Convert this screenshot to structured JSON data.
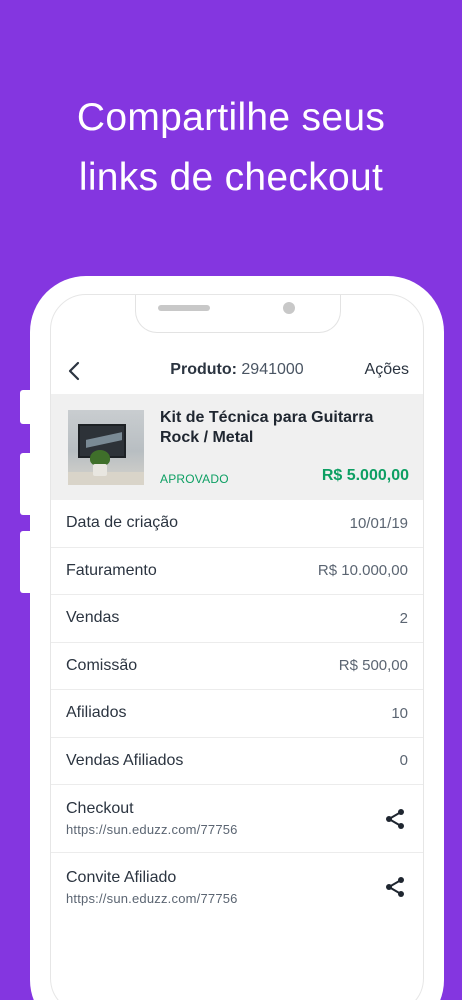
{
  "headline": {
    "line1": "Compartilhe seus",
    "line2": "links de checkout"
  },
  "header": {
    "back_icon": "chevron-left-icon",
    "title_label": "Produto:",
    "title_value": "2941000",
    "actions_label": "Ações"
  },
  "product": {
    "name": "Kit de Técnica para Guitarra Rock / Metal",
    "status": "APROVADO",
    "price": "R$ 5.000,00",
    "accent_color": "#0d9f63"
  },
  "details": [
    {
      "label": "Data de criação",
      "value": "10/01/19"
    },
    {
      "label": "Faturamento",
      "value": "R$ 10.000,00"
    },
    {
      "label": "Vendas",
      "value": "2"
    },
    {
      "label": "Comissão",
      "value": "R$ 500,00"
    },
    {
      "label": "Afiliados",
      "value": "10"
    },
    {
      "label": "Vendas Afiliados",
      "value": "0"
    }
  ],
  "links": [
    {
      "label": "Checkout",
      "url": "https://sun.eduzz.com/77756",
      "icon": "share-icon"
    },
    {
      "label": "Convite Afiliado",
      "url": "https://sun.eduzz.com/77756",
      "icon": "share-icon"
    }
  ],
  "colors": {
    "background": "#8436e0",
    "text": "#2b3440"
  }
}
